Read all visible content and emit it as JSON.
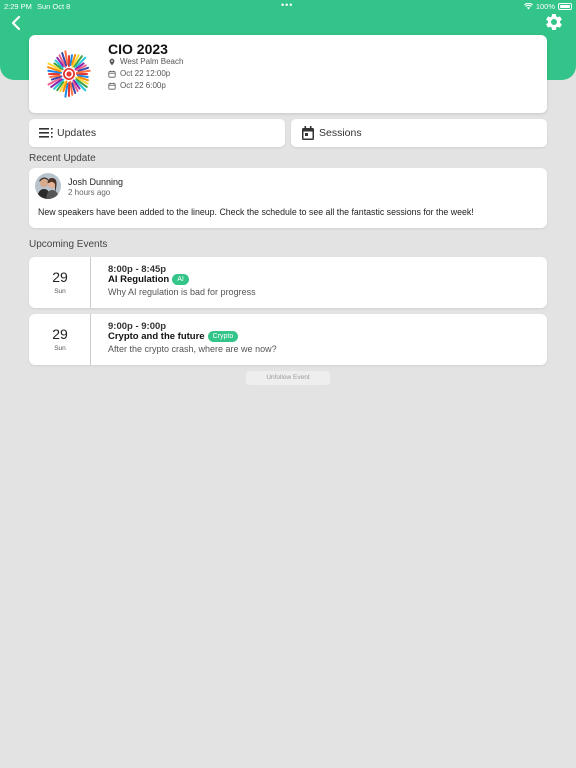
{
  "status_bar": {
    "time": "2:29 PM",
    "date": "Sun Oct 8",
    "battery": "100%"
  },
  "colors": {
    "accent": "#33c48a",
    "background": "#e3e3e3"
  },
  "icons": {
    "back": "chevron-left-icon",
    "settings": "gear-icon",
    "location": "map-pin-icon",
    "calendar": "calendar-icon",
    "updates": "list-icon",
    "sessions": "calendar-icon"
  },
  "event": {
    "title": "CIO 2023",
    "location": "West Palm Beach",
    "start": "Oct 22 12:00p",
    "end": "Oct 22 6:00p"
  },
  "tabs": {
    "updates_label": "Updates",
    "sessions_label": "Sessions"
  },
  "recent_update": {
    "section_title": "Recent Update",
    "author": "Josh Dunning",
    "posted": "2 hours ago",
    "text": "New speakers have been added to the lineup. Check the schedule to see all the fantastic sessions for the week!"
  },
  "upcoming": {
    "section_title": "Upcoming Events",
    "sessions": [
      {
        "day": "29",
        "weekday": "Sun",
        "time": "8:00p - 8:45p",
        "title": "AI Regulation",
        "tag": "AI",
        "description": "Why AI regulation is bad for progress"
      },
      {
        "day": "29",
        "weekday": "Sun",
        "time": "9:00p - 9:00p",
        "title": "Crypto and the future",
        "tag": "Crypto",
        "description": "After the crypto crash, where are we now?"
      }
    ]
  },
  "actions": {
    "unfollow_label": "Unfollow Event"
  }
}
